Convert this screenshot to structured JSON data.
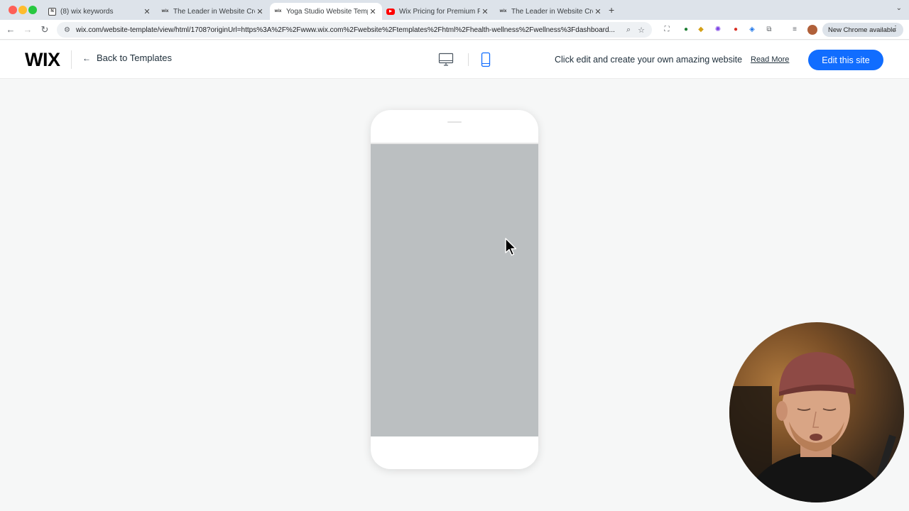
{
  "browser": {
    "tabs": [
      {
        "title": "(8) wix keywords",
        "icon": "notion-icon",
        "active": false
      },
      {
        "title": "The Leader in Website Creati...",
        "icon": "wix-favicon",
        "active": false
      },
      {
        "title": "Yoga Studio Website Templat...",
        "icon": "wix-favicon",
        "active": true
      },
      {
        "title": "Wix Pricing for Premium Plan...",
        "icon": "youtube-icon",
        "active": false
      },
      {
        "title": "The Leader in Website Creati...",
        "icon": "wix-favicon",
        "active": false
      }
    ],
    "url": "wix.com/website-template/view/html/1708?originUrl=https%3A%2F%2Fwww.wix.com%2Fwebsite%2Ftemplates%2Fhtml%2Fhealth-wellness%2Fwellness%3Fdashboard...",
    "new_chrome_label": "New Chrome available"
  },
  "wix_header": {
    "logo": "WIX",
    "back_label": "Back to Templates",
    "tagline": "Click edit and create your own amazing website",
    "read_more": "Read More",
    "edit_button": "Edit this site",
    "view_mode": "mobile"
  },
  "colors": {
    "accent": "#116dff",
    "phone_screen": "#bbbfc1",
    "page_bg": "#f6f7f7"
  }
}
